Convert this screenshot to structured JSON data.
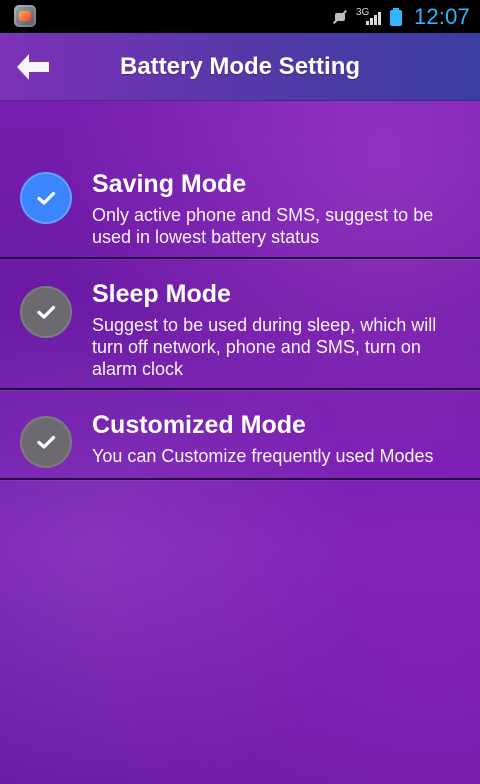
{
  "status_bar": {
    "app_icon": "app-icon",
    "network_type": "3G",
    "time": "12:07",
    "icons": [
      "mute-icon",
      "signal-icon",
      "battery-icon"
    ],
    "accent_color": "#2fb5ff"
  },
  "header": {
    "title": "Battery Mode Setting",
    "back_icon": "back-arrow-icon"
  },
  "modes": [
    {
      "title": "Saving Mode",
      "description": "Only active phone and SMS, suggest to be used in lowest battery status",
      "selected": true,
      "icon": "checkmark-icon",
      "icon_color": "#3b86ff"
    },
    {
      "title": "Sleep Mode",
      "description": "Suggest to be used during sleep, which will turn off network, phone and SMS, turn on alarm clock",
      "selected": false,
      "icon": "checkmark-icon",
      "icon_color": "#6c6a6e"
    },
    {
      "title": "Customized Mode",
      "description": "You can Customize frequently used Modes",
      "selected": false,
      "icon": "checkmark-icon",
      "icon_color": "#6c6a6e"
    }
  ]
}
